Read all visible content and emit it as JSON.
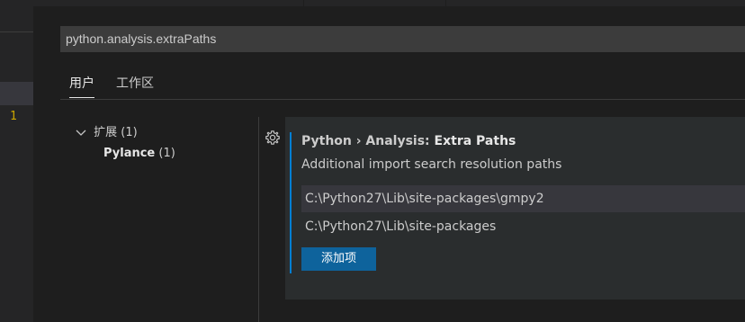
{
  "editor": {
    "line_number": "1"
  },
  "search": {
    "value": "python.analysis.extraPaths"
  },
  "scope_tabs": {
    "user": "用户",
    "workspace": "工作区"
  },
  "toc": {
    "group_label": "扩展",
    "group_count": "(1)",
    "item_label": "Pylance",
    "item_count": "(1)"
  },
  "setting": {
    "category": "Python › Analysis: ",
    "key": "Extra Paths",
    "description": "Additional import search resolution paths",
    "items": [
      "C:\\Python27\\Lib\\site-packages\\gmpy2",
      "C:\\Python27\\Lib\\site-packages"
    ],
    "add_button_label": "添加项"
  },
  "colors": {
    "background": "#1e1e1e",
    "setting_bg": "#2a2d2e",
    "accent": "#007fd4",
    "button": "#0e639c",
    "line_number": "#cca700"
  },
  "icons": {
    "gear": "gear-icon",
    "chevron": "chevron-down-icon"
  }
}
